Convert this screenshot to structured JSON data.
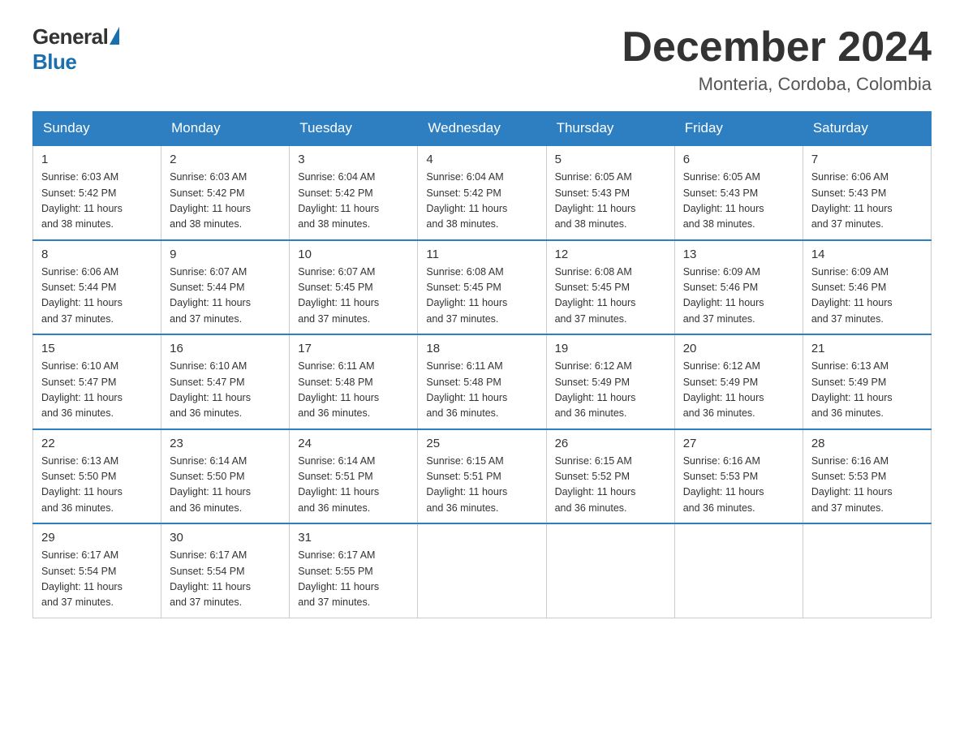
{
  "header": {
    "logo_general": "General",
    "logo_blue": "Blue",
    "month_title": "December 2024",
    "location": "Monteria, Cordoba, Colombia"
  },
  "days_of_week": [
    "Sunday",
    "Monday",
    "Tuesday",
    "Wednesday",
    "Thursday",
    "Friday",
    "Saturday"
  ],
  "weeks": [
    [
      {
        "day": "1",
        "sunrise": "6:03 AM",
        "sunset": "5:42 PM",
        "daylight": "11 hours and 38 minutes."
      },
      {
        "day": "2",
        "sunrise": "6:03 AM",
        "sunset": "5:42 PM",
        "daylight": "11 hours and 38 minutes."
      },
      {
        "day": "3",
        "sunrise": "6:04 AM",
        "sunset": "5:42 PM",
        "daylight": "11 hours and 38 minutes."
      },
      {
        "day": "4",
        "sunrise": "6:04 AM",
        "sunset": "5:42 PM",
        "daylight": "11 hours and 38 minutes."
      },
      {
        "day": "5",
        "sunrise": "6:05 AM",
        "sunset": "5:43 PM",
        "daylight": "11 hours and 38 minutes."
      },
      {
        "day": "6",
        "sunrise": "6:05 AM",
        "sunset": "5:43 PM",
        "daylight": "11 hours and 38 minutes."
      },
      {
        "day": "7",
        "sunrise": "6:06 AM",
        "sunset": "5:43 PM",
        "daylight": "11 hours and 37 minutes."
      }
    ],
    [
      {
        "day": "8",
        "sunrise": "6:06 AM",
        "sunset": "5:44 PM",
        "daylight": "11 hours and 37 minutes."
      },
      {
        "day": "9",
        "sunrise": "6:07 AM",
        "sunset": "5:44 PM",
        "daylight": "11 hours and 37 minutes."
      },
      {
        "day": "10",
        "sunrise": "6:07 AM",
        "sunset": "5:45 PM",
        "daylight": "11 hours and 37 minutes."
      },
      {
        "day": "11",
        "sunrise": "6:08 AM",
        "sunset": "5:45 PM",
        "daylight": "11 hours and 37 minutes."
      },
      {
        "day": "12",
        "sunrise": "6:08 AM",
        "sunset": "5:45 PM",
        "daylight": "11 hours and 37 minutes."
      },
      {
        "day": "13",
        "sunrise": "6:09 AM",
        "sunset": "5:46 PM",
        "daylight": "11 hours and 37 minutes."
      },
      {
        "day": "14",
        "sunrise": "6:09 AM",
        "sunset": "5:46 PM",
        "daylight": "11 hours and 37 minutes."
      }
    ],
    [
      {
        "day": "15",
        "sunrise": "6:10 AM",
        "sunset": "5:47 PM",
        "daylight": "11 hours and 36 minutes."
      },
      {
        "day": "16",
        "sunrise": "6:10 AM",
        "sunset": "5:47 PM",
        "daylight": "11 hours and 36 minutes."
      },
      {
        "day": "17",
        "sunrise": "6:11 AM",
        "sunset": "5:48 PM",
        "daylight": "11 hours and 36 minutes."
      },
      {
        "day": "18",
        "sunrise": "6:11 AM",
        "sunset": "5:48 PM",
        "daylight": "11 hours and 36 minutes."
      },
      {
        "day": "19",
        "sunrise": "6:12 AM",
        "sunset": "5:49 PM",
        "daylight": "11 hours and 36 minutes."
      },
      {
        "day": "20",
        "sunrise": "6:12 AM",
        "sunset": "5:49 PM",
        "daylight": "11 hours and 36 minutes."
      },
      {
        "day": "21",
        "sunrise": "6:13 AM",
        "sunset": "5:49 PM",
        "daylight": "11 hours and 36 minutes."
      }
    ],
    [
      {
        "day": "22",
        "sunrise": "6:13 AM",
        "sunset": "5:50 PM",
        "daylight": "11 hours and 36 minutes."
      },
      {
        "day": "23",
        "sunrise": "6:14 AM",
        "sunset": "5:50 PM",
        "daylight": "11 hours and 36 minutes."
      },
      {
        "day": "24",
        "sunrise": "6:14 AM",
        "sunset": "5:51 PM",
        "daylight": "11 hours and 36 minutes."
      },
      {
        "day": "25",
        "sunrise": "6:15 AM",
        "sunset": "5:51 PM",
        "daylight": "11 hours and 36 minutes."
      },
      {
        "day": "26",
        "sunrise": "6:15 AM",
        "sunset": "5:52 PM",
        "daylight": "11 hours and 36 minutes."
      },
      {
        "day": "27",
        "sunrise": "6:16 AM",
        "sunset": "5:53 PM",
        "daylight": "11 hours and 36 minutes."
      },
      {
        "day": "28",
        "sunrise": "6:16 AM",
        "sunset": "5:53 PM",
        "daylight": "11 hours and 37 minutes."
      }
    ],
    [
      {
        "day": "29",
        "sunrise": "6:17 AM",
        "sunset": "5:54 PM",
        "daylight": "11 hours and 37 minutes."
      },
      {
        "day": "30",
        "sunrise": "6:17 AM",
        "sunset": "5:54 PM",
        "daylight": "11 hours and 37 minutes."
      },
      {
        "day": "31",
        "sunrise": "6:17 AM",
        "sunset": "5:55 PM",
        "daylight": "11 hours and 37 minutes."
      },
      null,
      null,
      null,
      null
    ]
  ],
  "labels": {
    "sunrise": "Sunrise:",
    "sunset": "Sunset:",
    "daylight": "Daylight:"
  }
}
